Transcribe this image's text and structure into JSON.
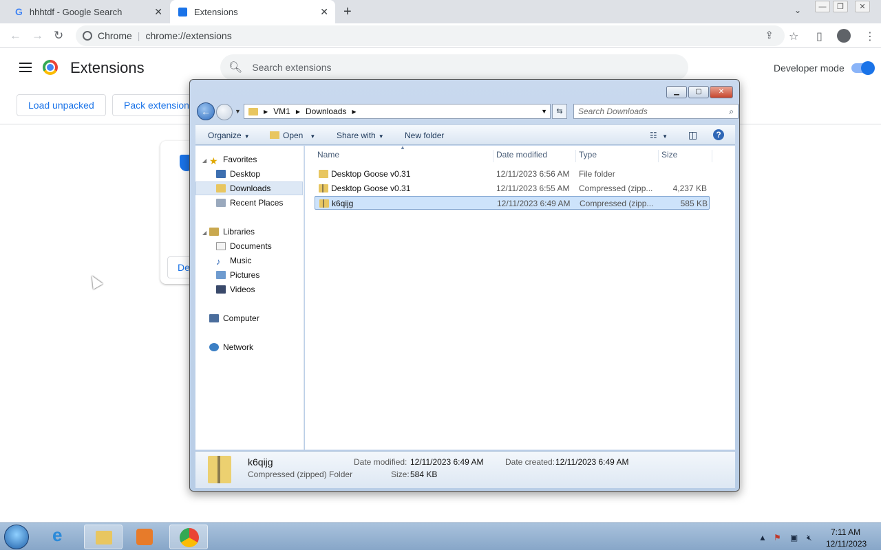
{
  "browser": {
    "tabs": [
      {
        "title": "hhhtdf - Google Search",
        "icon": "google-icon"
      },
      {
        "title": "Extensions",
        "icon": "puzzle-icon"
      }
    ],
    "omnibox": {
      "site": "Chrome",
      "url": "chrome://extensions"
    }
  },
  "extensions_page": {
    "title": "Extensions",
    "search_placeholder": "Search extensions",
    "developer_mode_label": "Developer mode",
    "developer_mode_on": true,
    "buttons": {
      "load_unpacked": "Load unpacked",
      "pack_extension": "Pack extension"
    },
    "card_details_button": "De"
  },
  "explorer": {
    "breadcrumb": [
      "VM1",
      "Downloads"
    ],
    "search_placeholder": "Search Downloads",
    "commands": {
      "organize": "Organize",
      "open": "Open",
      "share_with": "Share with",
      "new_folder": "New folder"
    },
    "nav": {
      "favorites": "Favorites",
      "desktop": "Desktop",
      "downloads": "Downloads",
      "recent_places": "Recent Places",
      "libraries": "Libraries",
      "documents": "Documents",
      "music": "Music",
      "pictures": "Pictures",
      "videos": "Videos",
      "computer": "Computer",
      "network": "Network"
    },
    "columns": {
      "name": "Name",
      "date_modified": "Date modified",
      "type": "Type",
      "size": "Size"
    },
    "files": [
      {
        "name": "Desktop Goose v0.31",
        "date": "12/11/2023 6:56 AM",
        "type": "File folder",
        "size": ""
      },
      {
        "name": "Desktop Goose v0.31",
        "date": "12/11/2023 6:55 AM",
        "type": "Compressed (zipp...",
        "size": "4,237 KB"
      },
      {
        "name": "k6qijg",
        "date": "12/11/2023 6:49 AM",
        "type": "Compressed (zipp...",
        "size": "585 KB"
      }
    ],
    "details": {
      "name": "k6qijg",
      "type": "Compressed (zipped) Folder",
      "date_modified_label": "Date modified:",
      "date_modified": "12/11/2023 6:49 AM",
      "size_label": "Size:",
      "size": "584 KB",
      "date_created_label": "Date created:",
      "date_created": "12/11/2023 6:49 AM"
    }
  },
  "taskbar": {
    "apps": [
      "internet-explorer-icon",
      "windows-explorer-icon",
      "media-player-icon",
      "chrome-icon"
    ],
    "clock_time": "7:11 AM",
    "clock_date": "12/11/2023"
  }
}
